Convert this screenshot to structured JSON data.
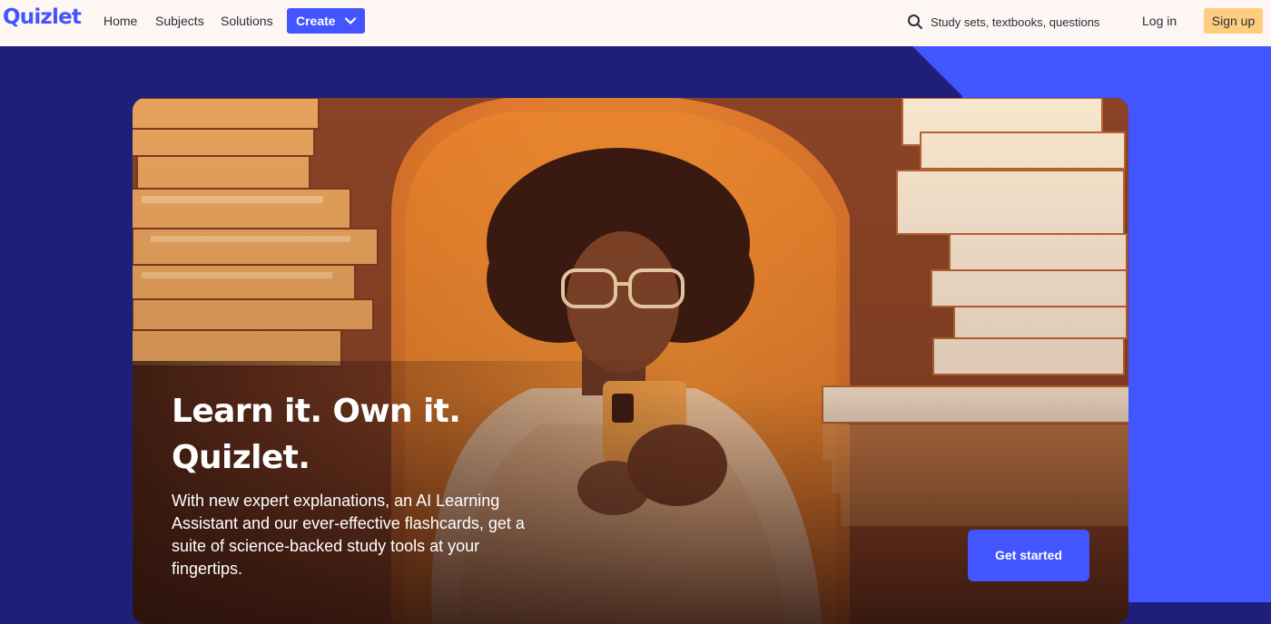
{
  "header": {
    "logo": "Quizlet",
    "nav": [
      "Home",
      "Subjects",
      "Solutions"
    ],
    "create_label": "Create",
    "search_placeholder": "Study sets, textbooks, questions",
    "login_label": "Log in",
    "signup_label": "Sign up"
  },
  "hero": {
    "title_line1": "Learn it. Own it.",
    "title_line2": "Quizlet.",
    "body": "With new expert explanations, an AI Learning Assistant and our ever-effective flashcards, get a suite of science-backed study tools at your fingertips.",
    "cta_label": "Get started"
  },
  "colors": {
    "brand_blue": "#4255ff",
    "page_navy": "#1f1f7a",
    "signup_yellow": "#ffcd80",
    "header_bg": "#fdf6f2"
  },
  "icons": [
    "search-icon",
    "chevron-down-icon"
  ]
}
